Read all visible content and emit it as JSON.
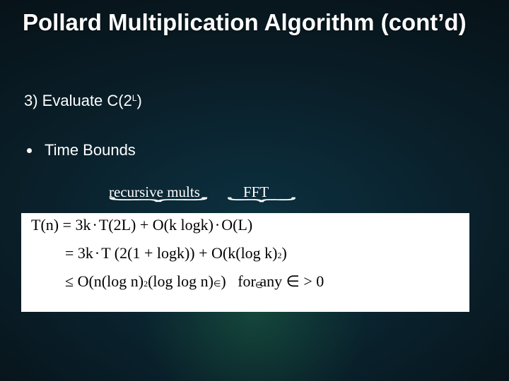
{
  "title": "Pollard Multiplication Algorithm (cont’d)",
  "step3_prefix": "3) Evaluate C(2",
  "step3_sup": "L",
  "step3_suffix": ")",
  "bullet_label": "Time Bounds",
  "anno_recursive": "recursive mults",
  "anno_fft": "FFT",
  "brace_glyph": "︸",
  "math": {
    "line1": {
      "lhs": "T(n) = 3k",
      "dot1": "·",
      "mid1": "T(2L) + O(k logk)",
      "dot2": "·",
      "tail": "O(L)"
    },
    "line2": {
      "eq": "= 3k",
      "dot": "·",
      "rest_a": "T (2(1 + logk)) + O(k(log k)",
      "exp2a": "2",
      "rest_b": ")"
    },
    "line3": {
      "le": "≤ O(n(log n)",
      "exp2": "2",
      "mid": "(log log n)",
      "expE": "∈",
      "close": ")",
      "forany": "   for any ∈ > 0"
    },
    "eps_over": "∈"
  }
}
